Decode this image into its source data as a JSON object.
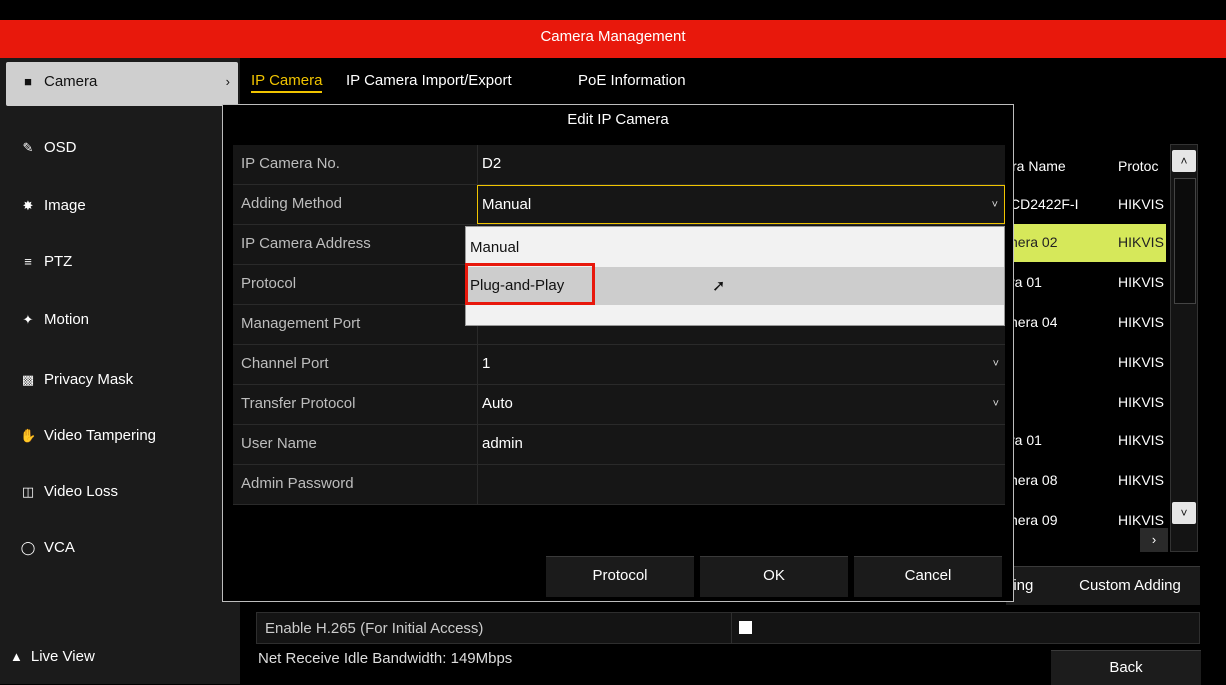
{
  "title": "Camera Management",
  "sidebar": {
    "items": [
      {
        "label": "Camera",
        "icon": "camera-icon"
      },
      {
        "label": "OSD",
        "icon": "osd-icon"
      },
      {
        "label": "Image",
        "icon": "image-icon"
      },
      {
        "label": "PTZ",
        "icon": "ptz-icon"
      },
      {
        "label": "Motion",
        "icon": "motion-icon"
      },
      {
        "label": "Privacy Mask",
        "icon": "privacy-mask-icon"
      },
      {
        "label": "Video Tampering",
        "icon": "hand-icon"
      },
      {
        "label": "Video Loss",
        "icon": "video-loss-icon"
      },
      {
        "label": "VCA",
        "icon": "vca-icon"
      }
    ],
    "live_view": "Live View"
  },
  "tabs": [
    "IP Camera",
    "IP Camera Import/Export",
    "PoE Information"
  ],
  "background_table": {
    "headers": [
      "ra Name",
      "Protoc"
    ],
    "rows": [
      [
        "CD2422F-I",
        "HIKVIS"
      ],
      [
        "nera 02",
        "HIKVIS"
      ],
      [
        "ra 01",
        "HIKVIS"
      ],
      [
        "nera 04",
        "HIKVIS"
      ],
      [
        "",
        "HIKVIS"
      ],
      [
        "",
        "HIKVIS"
      ],
      [
        "ra 01",
        "HIKVIS"
      ],
      [
        "nera 08",
        "HIKVIS"
      ],
      [
        "nera 09",
        "HIKVIS"
      ]
    ],
    "buttons": [
      "ling",
      "Custom Adding"
    ]
  },
  "h265": {
    "label": "Enable H.265 (For Initial Access)"
  },
  "net_bandwidth": "Net Receive Idle Bandwidth: 149Mbps",
  "back_label": "Back",
  "dialog": {
    "title": "Edit IP Camera",
    "fields": [
      {
        "label": "IP Camera No.",
        "value": "D2"
      },
      {
        "label": "Adding Method",
        "value": "Manual"
      },
      {
        "label": "IP Camera Address",
        "value": ""
      },
      {
        "label": "Protocol",
        "value": ""
      },
      {
        "label": "Management Port",
        "value": ""
      },
      {
        "label": "Channel Port",
        "value": "1"
      },
      {
        "label": "Transfer Protocol",
        "value": "Auto"
      },
      {
        "label": "User Name",
        "value": "admin"
      },
      {
        "label": "Admin Password",
        "value": ""
      }
    ],
    "dropdown_options": [
      "Manual",
      "Plug-and-Play"
    ],
    "buttons": {
      "protocol": "Protocol",
      "ok": "OK",
      "cancel": "Cancel"
    }
  },
  "colors": {
    "brand": "#e8180c",
    "active_tab": "#f0c400",
    "row_highlight": "#d6e85a"
  }
}
